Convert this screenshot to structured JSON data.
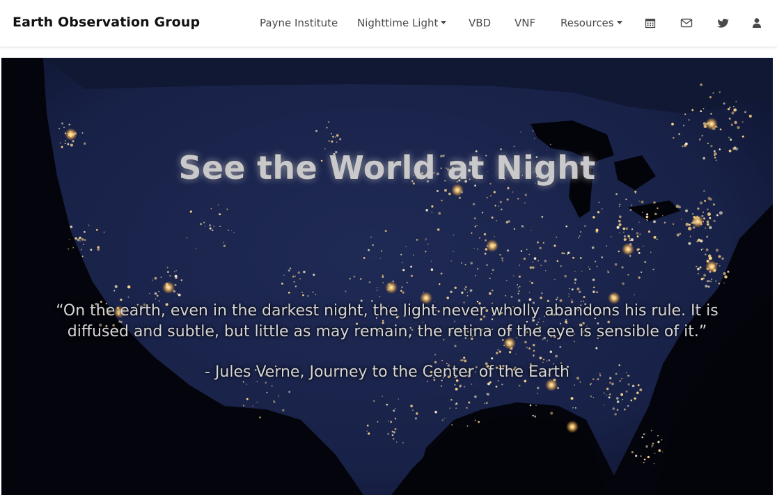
{
  "brand": "Earth Observation Group",
  "nav": {
    "items": [
      {
        "label": "Payne Institute",
        "dropdown": false
      },
      {
        "label": "Nighttime Light",
        "dropdown": true
      },
      {
        "label": "VBD",
        "dropdown": false
      },
      {
        "label": "VNF",
        "dropdown": false
      },
      {
        "label": "Resources",
        "dropdown": true
      }
    ],
    "icons": [
      "calendar-icon",
      "envelope-icon",
      "twitter-icon",
      "user-icon"
    ]
  },
  "hero": {
    "title": "See the World at Night",
    "quote": "“On the earth, even in the darkest night, the light never wholly abandons his rule. It is diffused and subtle, but little as may remain, the retina of the eye is sensible of it.”",
    "attribution": "- Jules Verne, Journey to the Center of the Earth",
    "background_image": "night-lights-map-usa"
  },
  "colors": {
    "navbar_bg": "#ffffff",
    "nav_text": "#4a4a4a",
    "brand_text": "#111111",
    "hero_bg": "#05060f",
    "land_night": "#1b2448",
    "city_light": "#ffd88a",
    "hero_text": "#d6d6d8"
  }
}
